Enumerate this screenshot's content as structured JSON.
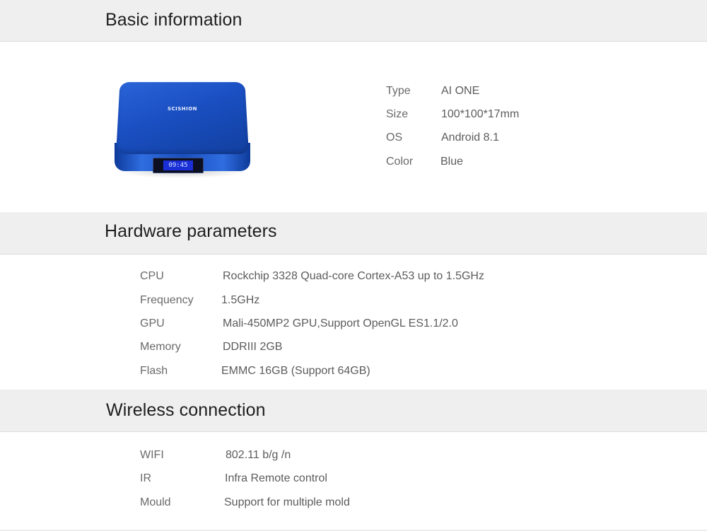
{
  "sections": {
    "basic": {
      "title": "Basic information",
      "device": {
        "brand": "SCISHION",
        "clock": "09:45",
        "color_hex": "#1f56c8"
      },
      "rows": [
        {
          "label": "Type",
          "value": "AI ONE"
        },
        {
          "label": "Size",
          "value": "100*100*17mm"
        },
        {
          "label": "OS",
          "value": "Android 8.1"
        },
        {
          "label": "Color",
          "value": "Blue"
        }
      ]
    },
    "hardware": {
      "title": "Hardware parameters",
      "rows": [
        {
          "label": "CPU",
          "value": "Rockchip 3328 Quad-core Cortex-A53 up to 1.5GHz"
        },
        {
          "label": "Frequency",
          "value": "1.5GHz"
        },
        {
          "label": "GPU",
          "value": "Mali-450MP2 GPU,Support OpenGL ES1.1/2.0"
        },
        {
          "label": "Memory",
          "value": "DDRIII 2GB"
        },
        {
          "label": "Flash",
          "value": "EMMC 16GB (Support 64GB)"
        }
      ]
    },
    "wireless": {
      "title": "Wireless connection",
      "rows": [
        {
          "label": "WIFI",
          "value": "802.11 b/g /n"
        },
        {
          "label": "IR",
          "value": "Infra Remote control"
        },
        {
          "label": "Mould",
          "value": "Support for multiple mold"
        }
      ]
    }
  }
}
